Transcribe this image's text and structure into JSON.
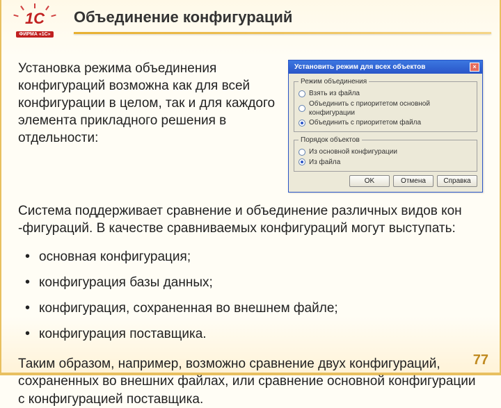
{
  "logo": {
    "brand": "1С",
    "sub": "ФИРМА «1С»"
  },
  "title": "Объединение конфигураций",
  "intro": "Установка режима объединения конфигураций возможна как для всей конфигурации в целом, так и для каждого элемента прикладного решения в отдельности:",
  "dialog": {
    "title": "Установить режим для всех объектов",
    "group1": {
      "legend": "Режим объединения",
      "opt1": "Взять из файла",
      "opt2": "Объединить с приоритетом основной конфигурации",
      "opt3": "Объединить с приоритетом файла"
    },
    "group2": {
      "legend": "Порядок объектов",
      "opt1": "Из основной конфигурации",
      "opt2": "Из файла"
    },
    "ok": "OK",
    "cancel": "Отмена",
    "help": "Справка"
  },
  "para1": "Система поддерживает сравнение и объединение различных видов кон -фигураций. В качестве сравниваемых конфигураций могут выступать:",
  "bullets": {
    "b1": "основная конфигурация;",
    "b2": "конфигурация базы данных;",
    "b3": "конфигурация, сохраненная во внешнем файле;",
    "b4": "конфигурация поставщика."
  },
  "para2": "Таким образом, например, возможно сравнение двух конфигураций, сохраненных во внешних файлах, или сравнение основной конфигурации с конфигурацией поставщика.",
  "page": "77"
}
